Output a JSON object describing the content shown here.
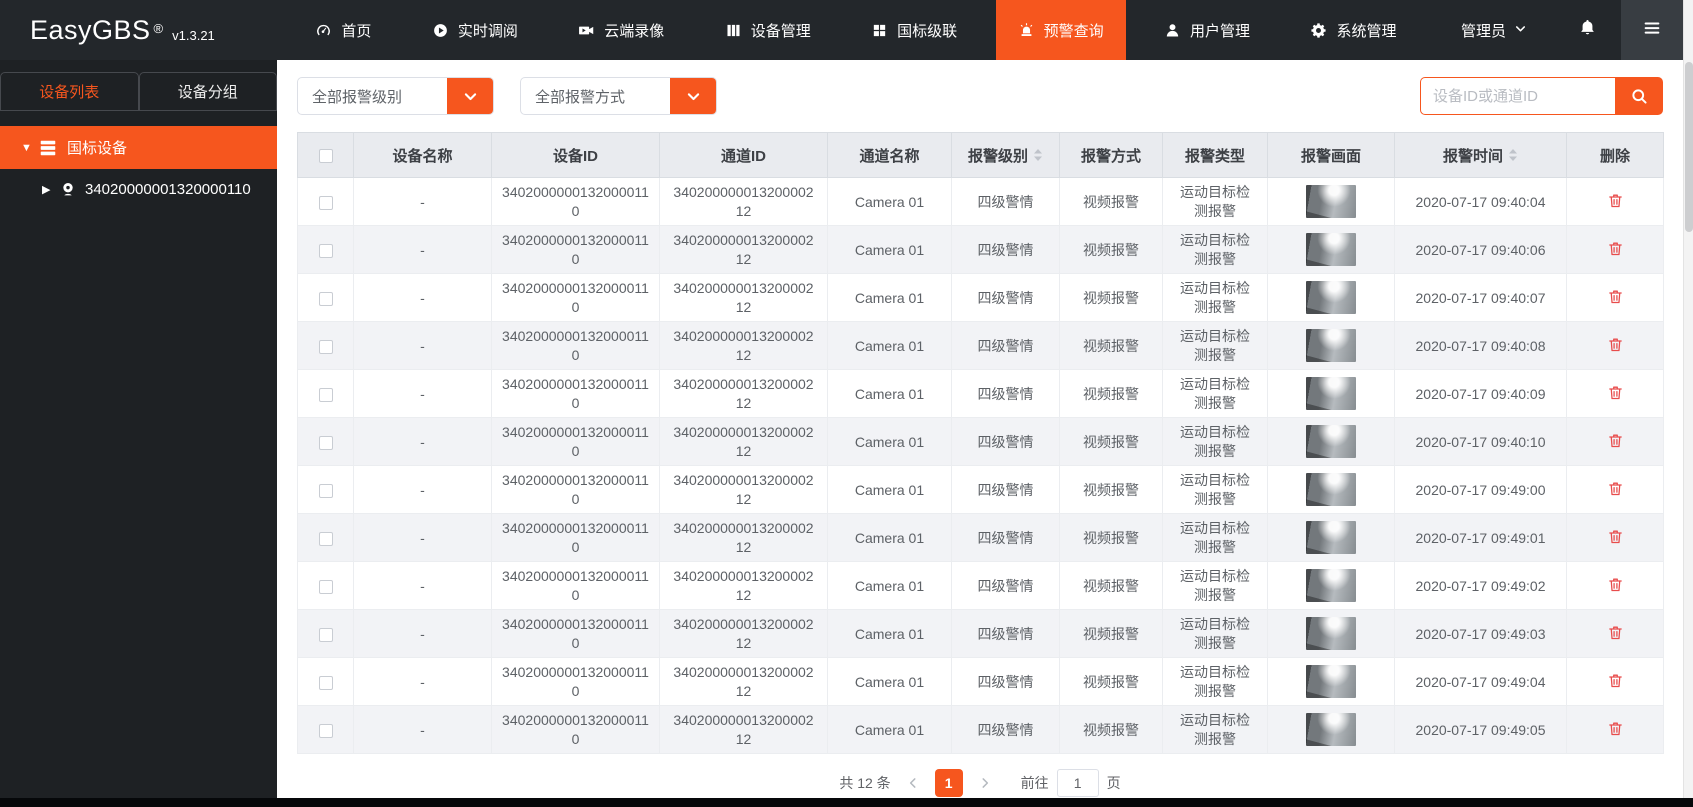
{
  "navbar": {
    "logo": "EasyGBS",
    "trademark": "®",
    "version": "v1.3.21",
    "items": [
      {
        "label": "首页",
        "icon": "dashboard-icon",
        "active": false
      },
      {
        "label": "实时调阅",
        "icon": "play-circle-icon",
        "active": false
      },
      {
        "label": "云端录像",
        "icon": "video-camera-icon",
        "active": false
      },
      {
        "label": "设备管理",
        "icon": "columns-icon",
        "active": false
      },
      {
        "label": "国标级联",
        "icon": "grid-icon",
        "active": false
      },
      {
        "label": "预警查询",
        "icon": "siren-icon",
        "active": true
      },
      {
        "label": "用户管理",
        "icon": "user-icon",
        "active": false
      },
      {
        "label": "系统管理",
        "icon": "gear-icon",
        "active": false
      }
    ],
    "admin_label": "管理员"
  },
  "sidebar": {
    "tabs": [
      {
        "label": "设备列表",
        "active": true
      },
      {
        "label": "设备分组",
        "active": false
      }
    ],
    "tree_root": "国标设备",
    "tree_device": "34020000001320000110"
  },
  "filters": {
    "alarm_level": "全部报警级别",
    "alarm_method": "全部报警方式"
  },
  "search": {
    "placeholder": "设备ID或通道ID"
  },
  "table": {
    "headers": [
      "设备名称",
      "设备ID",
      "通道ID",
      "通道名称",
      "报警级别",
      "报警方式",
      "报警类型",
      "报警画面",
      "报警时间",
      "删除"
    ],
    "rows": [
      {
        "device_name": "-",
        "device_id": "34020000001320000110",
        "channel_id": "34020000001320000212",
        "channel_name": "Camera 01",
        "alarm_level": "四级警情",
        "alarm_method": "视频报警",
        "alarm_type": "运动目标检测报警",
        "alarm_time": "2020-07-17 09:40:04"
      },
      {
        "device_name": "-",
        "device_id": "34020000001320000110",
        "channel_id": "34020000001320000212",
        "channel_name": "Camera 01",
        "alarm_level": "四级警情",
        "alarm_method": "视频报警",
        "alarm_type": "运动目标检测报警",
        "alarm_time": "2020-07-17 09:40:06"
      },
      {
        "device_name": "-",
        "device_id": "34020000001320000110",
        "channel_id": "34020000001320000212",
        "channel_name": "Camera 01",
        "alarm_level": "四级警情",
        "alarm_method": "视频报警",
        "alarm_type": "运动目标检测报警",
        "alarm_time": "2020-07-17 09:40:07"
      },
      {
        "device_name": "-",
        "device_id": "34020000001320000110",
        "channel_id": "34020000001320000212",
        "channel_name": "Camera 01",
        "alarm_level": "四级警情",
        "alarm_method": "视频报警",
        "alarm_type": "运动目标检测报警",
        "alarm_time": "2020-07-17 09:40:08"
      },
      {
        "device_name": "-",
        "device_id": "34020000001320000110",
        "channel_id": "34020000001320000212",
        "channel_name": "Camera 01",
        "alarm_level": "四级警情",
        "alarm_method": "视频报警",
        "alarm_type": "运动目标检测报警",
        "alarm_time": "2020-07-17 09:40:09"
      },
      {
        "device_name": "-",
        "device_id": "34020000001320000110",
        "channel_id": "34020000001320000212",
        "channel_name": "Camera 01",
        "alarm_level": "四级警情",
        "alarm_method": "视频报警",
        "alarm_type": "运动目标检测报警",
        "alarm_time": "2020-07-17 09:40:10"
      },
      {
        "device_name": "-",
        "device_id": "34020000001320000110",
        "channel_id": "34020000001320000212",
        "channel_name": "Camera 01",
        "alarm_level": "四级警情",
        "alarm_method": "视频报警",
        "alarm_type": "运动目标检测报警",
        "alarm_time": "2020-07-17 09:49:00"
      },
      {
        "device_name": "-",
        "device_id": "34020000001320000110",
        "channel_id": "34020000001320000212",
        "channel_name": "Camera 01",
        "alarm_level": "四级警情",
        "alarm_method": "视频报警",
        "alarm_type": "运动目标检测报警",
        "alarm_time": "2020-07-17 09:49:01"
      },
      {
        "device_name": "-",
        "device_id": "34020000001320000110",
        "channel_id": "34020000001320000212",
        "channel_name": "Camera 01",
        "alarm_level": "四级警情",
        "alarm_method": "视频报警",
        "alarm_type": "运动目标检测报警",
        "alarm_time": "2020-07-17 09:49:02"
      },
      {
        "device_name": "-",
        "device_id": "34020000001320000110",
        "channel_id": "34020000001320000212",
        "channel_name": "Camera 01",
        "alarm_level": "四级警情",
        "alarm_method": "视频报警",
        "alarm_type": "运动目标检测报警",
        "alarm_time": "2020-07-17 09:49:03"
      },
      {
        "device_name": "-",
        "device_id": "34020000001320000110",
        "channel_id": "34020000001320000212",
        "channel_name": "Camera 01",
        "alarm_level": "四级警情",
        "alarm_method": "视频报警",
        "alarm_type": "运动目标检测报警",
        "alarm_time": "2020-07-17 09:49:04"
      },
      {
        "device_name": "-",
        "device_id": "34020000001320000110",
        "channel_id": "34020000001320000212",
        "channel_name": "Camera 01",
        "alarm_level": "四级警情",
        "alarm_method": "视频报警",
        "alarm_type": "运动目标检测报警",
        "alarm_time": "2020-07-17 09:49:05"
      }
    ]
  },
  "pagination": {
    "total": "共 12 条",
    "current_page": "1",
    "goto_label": "前往",
    "goto_value": "1",
    "page_unit": "页"
  },
  "colors": {
    "accent": "#f6561e",
    "navbar_bg": "#23272b",
    "sidebar_bg": "#1e2124",
    "header_bg": "#e9ebef",
    "danger": "#e84c4c"
  }
}
